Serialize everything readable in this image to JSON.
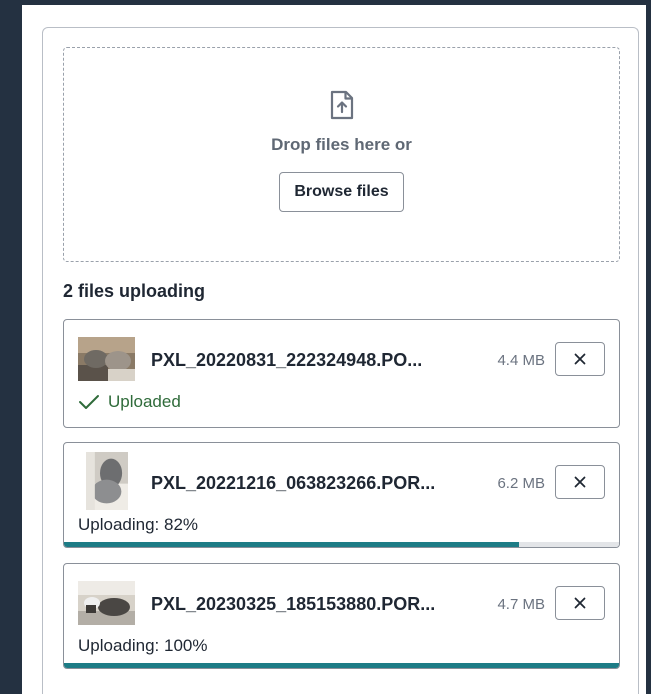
{
  "dropzone": {
    "prompt": "Drop files here or",
    "browse_label": "Browse files"
  },
  "uploads": {
    "heading": "2 files uploading",
    "files": [
      {
        "name": "PXL_20220831_222324948.PO...",
        "size": "4.4 MB",
        "status": "Uploaded",
        "state": "complete"
      },
      {
        "name": "PXL_20221216_063823266.POR...",
        "size": "6.2 MB",
        "status": "Uploading: 82%",
        "progress": 0.82
      },
      {
        "name": "PXL_20230325_185153880.POR...",
        "size": "4.7 MB",
        "status": "Uploading: 100%",
        "progress": 1.0
      }
    ]
  },
  "colors": {
    "progress": "#1d7c86",
    "success": "#2f6b3a",
    "sidebar": "#243141"
  },
  "icons": [
    "file-upload-icon",
    "checkmark-icon",
    "close-icon"
  ]
}
